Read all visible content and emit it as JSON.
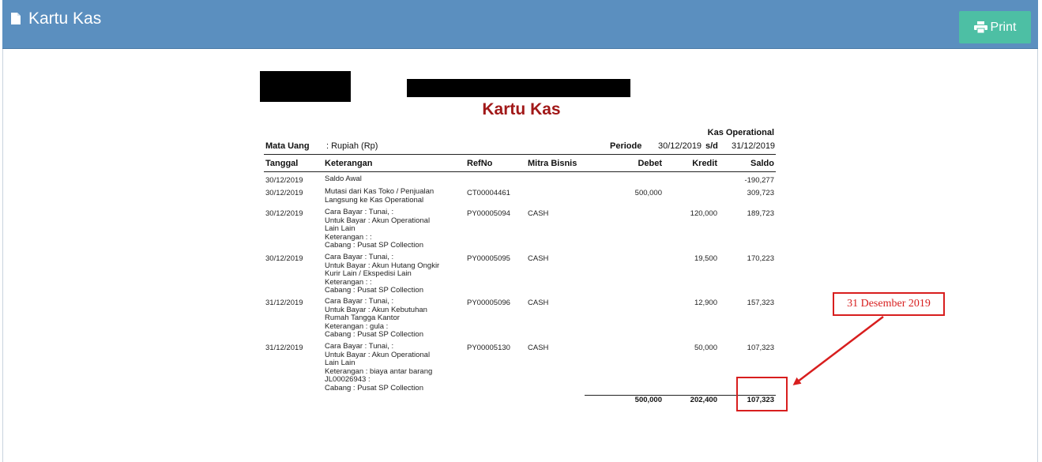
{
  "header": {
    "title": "Kartu Kas",
    "print_label": "Print",
    "color": "#5b8fbf",
    "print_color": "#4dbfa4"
  },
  "report": {
    "title": "Kartu Kas",
    "account": "Kas Operational",
    "currency_label": "Mata Uang",
    "currency_value": ":  Rupiah (Rp)",
    "period_label": "Periode",
    "period_from": "30/12/2019",
    "period_sep": "s/d",
    "period_to": "31/12/2019",
    "columns": [
      "Tanggal",
      "Keterangan",
      "RefNo",
      "Mitra Bisnis",
      "Debet",
      "Kredit",
      "Saldo"
    ],
    "rows": [
      {
        "tanggal": "30/12/2019",
        "keterangan": [
          "Saldo Awal"
        ],
        "refno": "",
        "mitra": "",
        "debet": "",
        "kredit": "",
        "saldo": "-190,277"
      },
      {
        "tanggal": "30/12/2019",
        "keterangan": [
          "Mutasi dari Kas Toko / Penjualan",
          "Langsung ke Kas Operational"
        ],
        "refno": "CT00004461",
        "mitra": "",
        "debet": "500,000",
        "kredit": "",
        "saldo": "309,723"
      },
      {
        "tanggal": "30/12/2019",
        "keterangan": [
          "Cara Bayar : Tunai,  :",
          "Untuk Bayar : Akun Operational",
          "Lain Lain",
          "Keterangan :  :",
          "Cabang : Pusat SP Collection"
        ],
        "refno": "PY00005094",
        "mitra": "CASH",
        "debet": "",
        "kredit": "120,000",
        "saldo": "189,723"
      },
      {
        "tanggal": "30/12/2019",
        "keterangan": [
          "Cara Bayar : Tunai,  :",
          "Untuk Bayar : Akun Hutang Ongkir",
          "Kurir Lain / Ekspedisi Lain",
          "Keterangan :  :",
          "Cabang : Pusat SP Collection"
        ],
        "refno": "PY00005095",
        "mitra": "CASH",
        "debet": "",
        "kredit": "19,500",
        "saldo": "170,223"
      },
      {
        "tanggal": "31/12/2019",
        "keterangan": [
          "Cara Bayar : Tunai,  :",
          "Untuk Bayar : Akun Kebutuhan",
          "Rumah Tangga Kantor",
          "Keterangan : gula :",
          "Cabang : Pusat SP Collection"
        ],
        "refno": "PY00005096",
        "mitra": "CASH",
        "debet": "",
        "kredit": "12,900",
        "saldo": "157,323"
      },
      {
        "tanggal": "31/12/2019",
        "keterangan": [
          "Cara Bayar : Tunai,  :",
          "Untuk Bayar : Akun Operational",
          "Lain Lain",
          "Keterangan : biaya antar barang",
          "JL00026943 :",
          "Cabang : Pusat SP Collection"
        ],
        "refno": "PY00005130",
        "mitra": "CASH",
        "debet": "",
        "kredit": "50,000",
        "saldo": "107,323"
      }
    ],
    "totals": {
      "debet": "500,000",
      "kredit": "202,400",
      "saldo": "107,323"
    }
  },
  "annotation": {
    "callout_text": "31 Desember 2019",
    "color": "#d81e1e"
  }
}
